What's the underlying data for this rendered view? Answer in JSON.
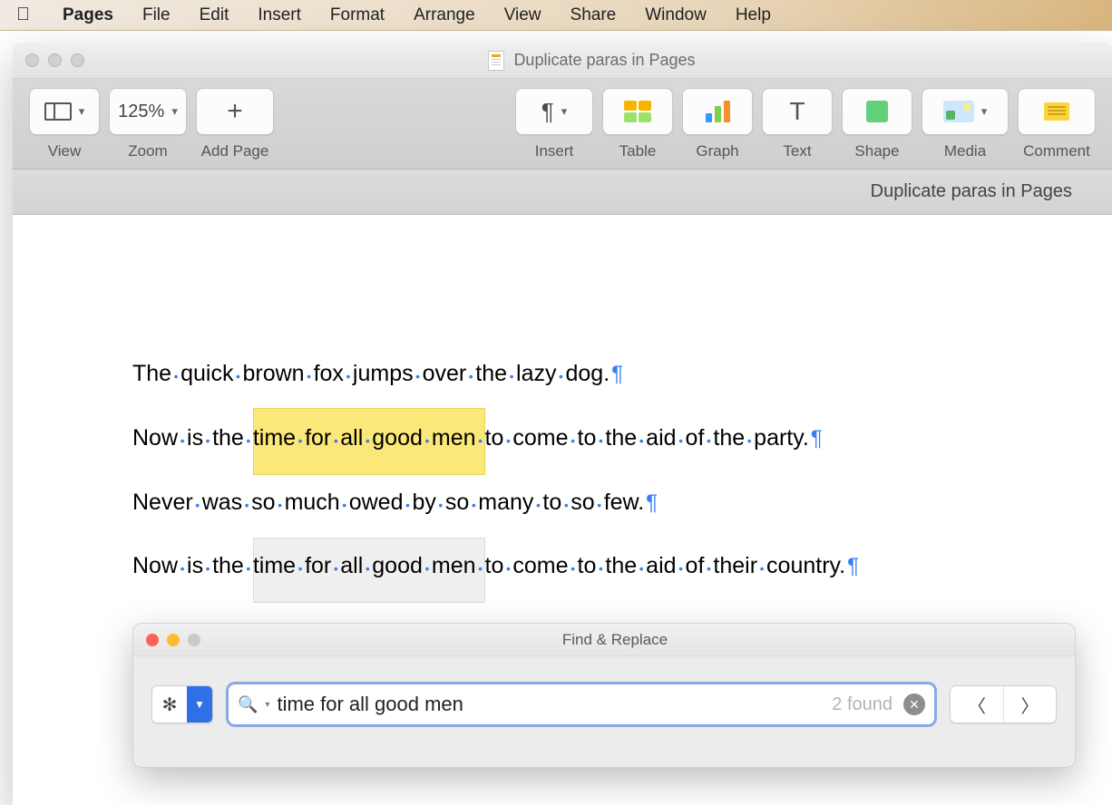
{
  "menubar": {
    "app": "Pages",
    "items": [
      "File",
      "Edit",
      "Insert",
      "Format",
      "Arrange",
      "View",
      "Share",
      "Window",
      "Help"
    ]
  },
  "window": {
    "title": "Duplicate paras in Pages",
    "tab_title": "Duplicate paras in Pages"
  },
  "toolbar": {
    "view": "View",
    "zoom_value": "125%",
    "zoom": "Zoom",
    "add_page": "Add Page",
    "insert": "Insert",
    "table": "Table",
    "graph": "Graph",
    "text": "Text",
    "shape": "Shape",
    "media": "Media",
    "comment": "Comment"
  },
  "document": {
    "paragraphs": [
      {
        "words": [
          "The",
          "quick",
          "brown",
          "fox",
          "jumps",
          "over",
          "the",
          "lazy",
          "dog."
        ],
        "highlight": null
      },
      {
        "words": [
          "Now",
          "is",
          "the",
          "time",
          "for",
          "all",
          "good",
          "men",
          "to",
          "come",
          "to",
          "the",
          "aid",
          "of",
          "the",
          "party."
        ],
        "highlight": {
          "start": 3,
          "end": 7,
          "style": "primary"
        }
      },
      {
        "words": [
          "Never",
          "was",
          "so",
          "much",
          "owed",
          "by",
          "so",
          "many",
          "to",
          "so",
          "few."
        ],
        "highlight": null
      },
      {
        "words": [
          "Now",
          "is",
          "the",
          "time",
          "for",
          "all",
          "good",
          "men",
          "to",
          "come",
          "to",
          "the",
          "aid",
          "of",
          "their",
          "country."
        ],
        "highlight": {
          "start": 3,
          "end": 7,
          "style": "secondary"
        }
      }
    ]
  },
  "find": {
    "panel_title": "Find & Replace",
    "query": "time for all good men",
    "result_count": "2 found"
  }
}
